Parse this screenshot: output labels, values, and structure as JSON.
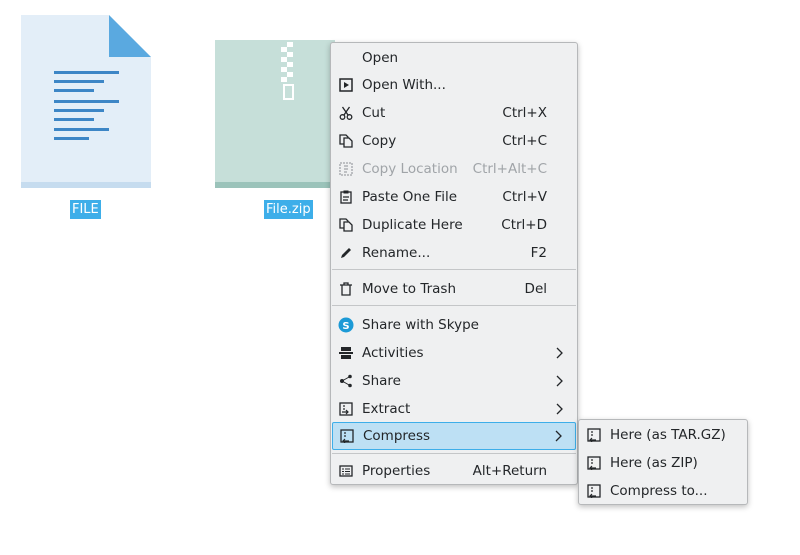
{
  "desktop": {
    "files": [
      {
        "name": "FILE",
        "icon": "text-document-icon"
      },
      {
        "name": "File.zip",
        "icon": "zip-archive-icon"
      }
    ]
  },
  "context_menu": {
    "items": [
      {
        "label": "Open",
        "shortcut": "",
        "icon": ""
      },
      {
        "label": "Open With...",
        "shortcut": "",
        "icon": "open-with-icon"
      },
      {
        "label": "Cut",
        "shortcut": "Ctrl+X",
        "icon": "scissors-icon"
      },
      {
        "label": "Copy",
        "shortcut": "Ctrl+C",
        "icon": "copy-icon"
      },
      {
        "label": "Copy Location",
        "shortcut": "Ctrl+Alt+C",
        "icon": "copy-location-icon",
        "disabled": true
      },
      {
        "label": "Paste One File",
        "shortcut": "Ctrl+V",
        "icon": "paste-icon"
      },
      {
        "label": "Duplicate Here",
        "shortcut": "Ctrl+D",
        "icon": "duplicate-icon"
      },
      {
        "label": "Rename...",
        "shortcut": "F2",
        "icon": "pencil-icon"
      },
      {
        "label": "Move to Trash",
        "shortcut": "Del",
        "icon": "trash-icon"
      },
      {
        "label": "Share with Skype",
        "shortcut": "",
        "icon": "skype-icon"
      },
      {
        "label": "Activities",
        "shortcut": "",
        "icon": "activities-icon",
        "submenu": true
      },
      {
        "label": "Share",
        "shortcut": "",
        "icon": "share-icon",
        "submenu": true
      },
      {
        "label": "Extract",
        "shortcut": "",
        "icon": "archive-extract-icon",
        "submenu": true
      },
      {
        "label": "Compress",
        "shortcut": "",
        "icon": "archive-compress-icon",
        "submenu": true,
        "highlighted": true
      },
      {
        "label": "Properties",
        "shortcut": "Alt+Return",
        "icon": "properties-icon"
      }
    ]
  },
  "compress_submenu": {
    "items": [
      {
        "label": "Here (as TAR.GZ)",
        "icon": "archive-icon"
      },
      {
        "label": "Here (as ZIP)",
        "icon": "archive-icon"
      },
      {
        "label": "Compress to...",
        "icon": "archive-icon"
      }
    ]
  },
  "colors": {
    "selection": "#3daee9",
    "highlight_bg": "#bde0f4",
    "menu_bg": "#eff0f1",
    "disabled_text": "#a0a4a8"
  }
}
